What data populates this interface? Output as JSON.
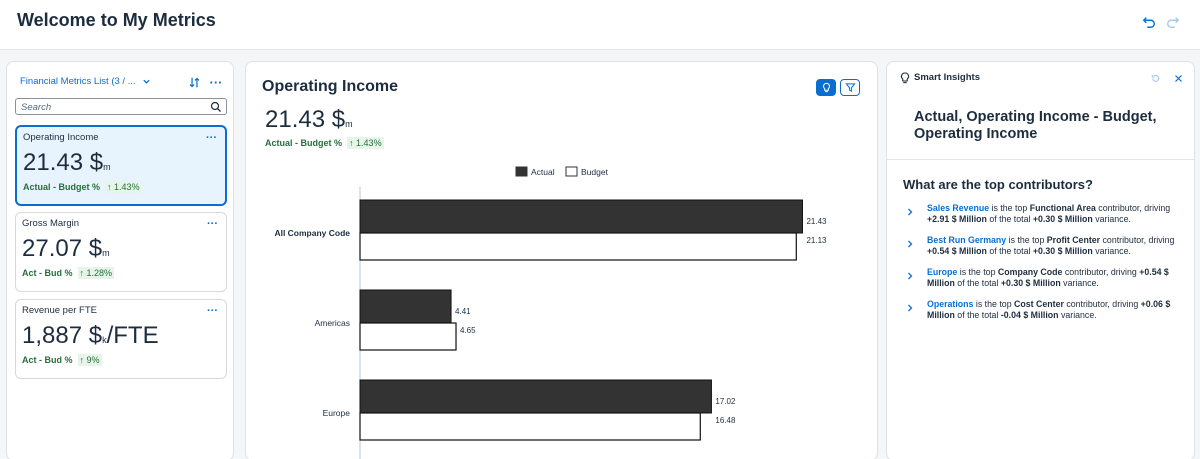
{
  "header": {
    "title": "Welcome to My Metrics"
  },
  "left": {
    "list_title": "Financial Metrics List (3 / ...",
    "search_placeholder": "Search",
    "cards": [
      {
        "label": "Operating Income",
        "value": "21.43 $",
        "unit": "m",
        "variance_label": "Actual - Budget %",
        "arrow": "↑",
        "variance": "1.43%",
        "selected": true
      },
      {
        "label": "Gross Margin",
        "value": "27.07 $",
        "unit": "m",
        "variance_label": "Act - Bud %",
        "arrow": "↑",
        "variance": "1.28%",
        "selected": false
      },
      {
        "label": "Revenue per FTE",
        "value": "1,887 $",
        "unit": "k",
        "unit_suffix": "/FTE",
        "variance_label": "Act - Bud %",
        "arrow": "↑",
        "variance": "9%",
        "selected": false
      }
    ]
  },
  "main": {
    "title": "Operating Income",
    "value": "21.43 $",
    "unit": "m",
    "variance_label": "Actual - Budget %",
    "arrow": "↑",
    "variance": "1.43%"
  },
  "chart_data": {
    "type": "bar",
    "orientation": "horizontal",
    "categories": [
      "All Company Code",
      "Americas",
      "Europe"
    ],
    "series": [
      {
        "name": "Actual",
        "values": [
          21.43,
          4.41,
          17.02
        ],
        "labels": [
          "21.43",
          "4.41",
          "17.02"
        ],
        "color": "#333333"
      },
      {
        "name": "Budget",
        "values": [
          21.13,
          4.65,
          16.48
        ],
        "labels": [
          "21.13",
          "4.65",
          "16.48"
        ],
        "color": "#ffffff"
      }
    ],
    "xlim": [
      0,
      21.6
    ],
    "legend": "top-center"
  },
  "insights": {
    "panel_title": "Smart Insights",
    "heading": "Actual, Operating Income - Budget, Operating Income",
    "question": "What are the top contributors?",
    "items": [
      {
        "link": "Sales Revenue",
        "t1": " is the top ",
        "dim": "Functional Area",
        "t2": " contributor, driving ",
        "v1": "+2.91 $ Million",
        "t3": " of the total ",
        "v2": "+0.30 $ Million",
        "t4": " variance."
      },
      {
        "link": "Best Run Germany",
        "t1": " is the top ",
        "dim": "Profit Center",
        "t2": " contributor, driving ",
        "v1": "+0.54 $ Million",
        "t3": " of the total ",
        "v2": "+0.30 $ Million",
        "t4": " variance."
      },
      {
        "link": "Europe",
        "t1": " is the top ",
        "dim": "Company Code",
        "t2": " contributor, driving ",
        "v1": "+0.54 $ Million",
        "t3": " of the total ",
        "v2": "+0.30 $ Million",
        "t4": " variance."
      },
      {
        "link": "Operations",
        "t1": " is the top ",
        "dim": "Cost Center",
        "t2": " contributor, driving ",
        "v1": "+0.06 $ Million",
        "t3": " of the total ",
        "v2": "-0.04 $ Million",
        "t4": " variance."
      }
    ]
  },
  "colors": {
    "accent": "#0a6ed1",
    "positive": "#256f3a",
    "bar_actual": "#333333"
  }
}
